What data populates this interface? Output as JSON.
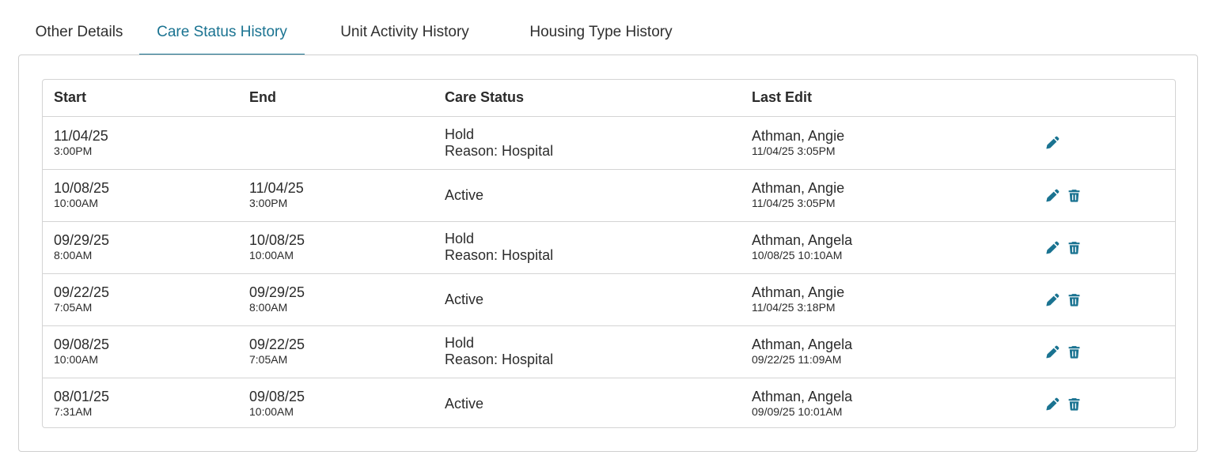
{
  "tabs": [
    {
      "label": "Other Details",
      "active": false
    },
    {
      "label": "Care Status History",
      "active": true
    },
    {
      "label": "Unit Activity History",
      "active": false
    },
    {
      "label": "Housing Type History",
      "active": false
    }
  ],
  "table": {
    "headers": {
      "start": "Start",
      "end": "End",
      "care_status": "Care Status",
      "last_edit": "Last Edit"
    },
    "rows": [
      {
        "start_date": "11/04/25",
        "start_time": "3:00PM",
        "end_date": "",
        "end_time": "",
        "status": "Hold",
        "reason": "Reason: Hospital",
        "editor": "Athman, Angie",
        "edit_time": "11/04/25 3:05PM",
        "can_delete": false
      },
      {
        "start_date": "10/08/25",
        "start_time": "10:00AM",
        "end_date": "11/04/25",
        "end_time": "3:00PM",
        "status": "Active",
        "reason": "",
        "editor": "Athman, Angie",
        "edit_time": "11/04/25 3:05PM",
        "can_delete": true
      },
      {
        "start_date": "09/29/25",
        "start_time": "8:00AM",
        "end_date": "10/08/25",
        "end_time": "10:00AM",
        "status": "Hold",
        "reason": "Reason: Hospital",
        "editor": "Athman, Angela",
        "edit_time": "10/08/25 10:10AM",
        "can_delete": true
      },
      {
        "start_date": "09/22/25",
        "start_time": "7:05AM",
        "end_date": "09/29/25",
        "end_time": "8:00AM",
        "status": "Active",
        "reason": "",
        "editor": "Athman, Angie",
        "edit_time": "11/04/25 3:18PM",
        "can_delete": true
      },
      {
        "start_date": "09/08/25",
        "start_time": "10:00AM",
        "end_date": "09/22/25",
        "end_time": "7:05AM",
        "status": "Hold",
        "reason": "Reason: Hospital",
        "editor": "Athman, Angela",
        "edit_time": "09/22/25 11:09AM",
        "can_delete": true
      },
      {
        "start_date": "08/01/25",
        "start_time": "7:31AM",
        "end_date": "09/08/25",
        "end_time": "10:00AM",
        "status": "Active",
        "reason": "",
        "editor": "Athman, Angela",
        "edit_time": "09/09/25 10:01AM",
        "can_delete": true
      }
    ]
  },
  "icons": {
    "edit": "pencil-icon",
    "delete": "trash-icon"
  },
  "colors": {
    "accent": "#1a7391",
    "border": "#d4d4d4",
    "text": "#2b2b2b"
  }
}
